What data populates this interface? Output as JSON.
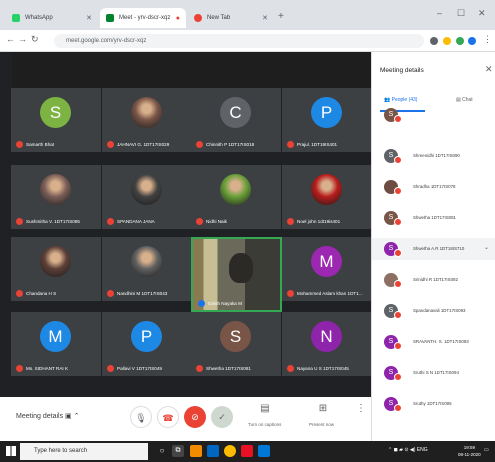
{
  "browser": {
    "tabs": [
      {
        "label": "WhatsApp",
        "favicon_color": "#25d366",
        "active": false
      },
      {
        "label": "Meet - yrv-dscr-xqz",
        "favicon_color": "#00832d",
        "active": true
      },
      {
        "label": "New Tab",
        "favicon_color": "#ea4335",
        "active": false
      }
    ],
    "url": "meet.google.com/yrv-dscr-xqz"
  },
  "tiles": [
    {
      "name": "Samarth Bhat",
      "letter": "S",
      "color": "#7cb342",
      "type": "letter"
    },
    {
      "name": "JAHNAVI G. 1DT17IS029",
      "letter": "",
      "color": "#795548",
      "type": "photo"
    },
    {
      "name": "Chinnith P 1DT17IS018",
      "letter": "C",
      "color": "#5f6368",
      "type": "letter"
    },
    {
      "name": "Prajul. 1DT19IS401",
      "letter": "P",
      "color": "#1e88e5",
      "type": "letter"
    },
    {
      "name": "Sushmitha V. 1DT17IS085",
      "letter": "",
      "color": "#7b5e57",
      "type": "photo"
    },
    {
      "name": "SPANDANA JANA",
      "letter": "",
      "color": "#424242",
      "type": "photo"
    },
    {
      "name": "Nidhi Naik",
      "letter": "",
      "color": "#689f38",
      "type": "photo"
    },
    {
      "name": "Noel john 1dt19is401",
      "letter": "",
      "color": "#b71c1c",
      "type": "photo"
    },
    {
      "name": "Chandana H S",
      "letter": "",
      "color": "#5d4037",
      "type": "photo"
    },
    {
      "name": "Nandhini M 1DT17IS043",
      "letter": "",
      "color": "#616161",
      "type": "photo"
    },
    {
      "name": "Mohammed Aslam khan 1DT1...",
      "letter": "M",
      "color": "#9c27b0",
      "type": "letter"
    },
    {
      "name": "Ms. SIDHANT RAI K",
      "letter": "M",
      "color": "#1e88e5",
      "type": "letter"
    },
    {
      "name": "Pallavi V 1DT17IS049",
      "letter": "P",
      "color": "#1e88e5",
      "type": "letter"
    },
    {
      "name": "Shwetha 1DT17IS081",
      "letter": "S",
      "color": "#795548",
      "type": "letter"
    },
    {
      "name": "Nayana U S 1DT17IS045",
      "letter": "N",
      "color": "#8e24aa",
      "type": "letter"
    }
  ],
  "presenter": {
    "name": "Girish Nayaka M"
  },
  "bottombar": {
    "meeting_details": "Meeting details",
    "captions_label": "Turn on captions",
    "present_label": "Present now"
  },
  "panel": {
    "title": "Meeting details",
    "people_tab": "People (43)",
    "chat_tab": "Chat",
    "people": [
      {
        "name": "",
        "letter": "S",
        "color": "#795548"
      },
      {
        "name": "Shreenidhi 1DT17IS090",
        "letter": "S",
        "color": "#5f6368"
      },
      {
        "name": "Shradha 1DT17IS078",
        "letter": "",
        "color": "#6d4c41"
      },
      {
        "name": "Shwetha 1DT17IS081",
        "letter": "S",
        "color": "#795548"
      },
      {
        "name": "Shwetha A.R 1DT18IS710",
        "letter": "S",
        "color": "#8e24aa"
      },
      {
        "name": "Srinidhi R 1DT17IS092",
        "letter": "",
        "color": "#8d6e63"
      },
      {
        "name": "Spandanavali 1DT17IS093",
        "letter": "S",
        "color": "#5f6368"
      },
      {
        "name": "SRAVANTH. S. 1DT17IS093",
        "letter": "S",
        "color": "#8e24aa"
      },
      {
        "name": "Sruthi S N 1DT17IS094",
        "letter": "S",
        "color": "#8e24aa"
      },
      {
        "name": "Sruthy 1DT17IS095",
        "letter": "S",
        "color": "#8e24aa"
      }
    ]
  },
  "taskbar": {
    "search_placeholder": "Type here to search",
    "time": "19:59",
    "date": "08-11-2020"
  }
}
